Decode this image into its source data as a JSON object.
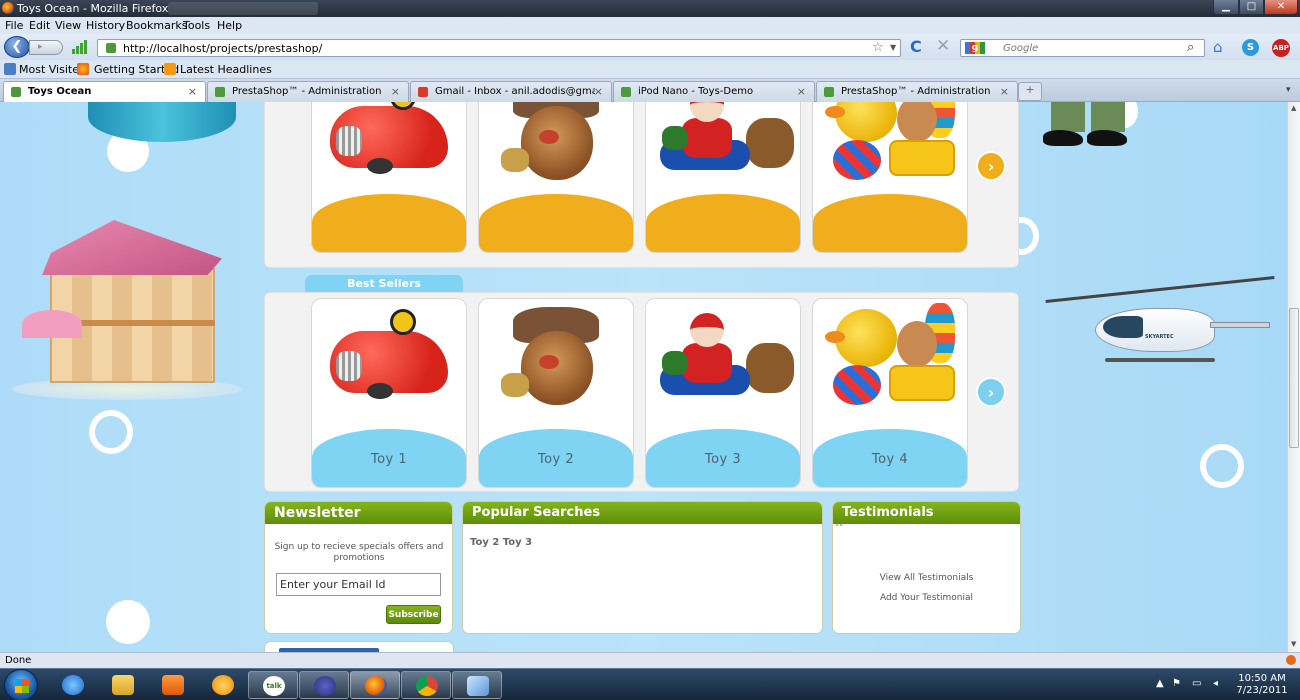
{
  "window": {
    "title": "Toys Ocean - Mozilla Firefox",
    "controls": {
      "minimize": "▁",
      "maximize": "□",
      "close": "✕"
    }
  },
  "menu": [
    "File",
    "Edit",
    "View",
    "History",
    "Bookmarks",
    "Tools",
    "Help"
  ],
  "nav": {
    "url": "http://localhost/projects/prestashop/",
    "search_placeholder": "Google",
    "back": "❮",
    "forward": "▸",
    "bookmark_star": "☆",
    "url_dropdown": "▼",
    "reload": "C",
    "stop": "✕",
    "home": "⌂",
    "search_engine_badge": "g",
    "search_lens": "⌕",
    "skype_badge": "S",
    "adblock_badge": "ABP"
  },
  "bookmarks": [
    "Most Visited",
    "Getting Started",
    "Latest Headlines"
  ],
  "tabs": [
    {
      "label": "Toys Ocean",
      "active": true
    },
    {
      "label": "PrestaShop™ - Administration panel",
      "active": false
    },
    {
      "label": "Gmail - Inbox - anil.adodis@gmail.c...",
      "active": false
    },
    {
      "label": "iPod Nano - Toys-Demo",
      "active": false
    },
    {
      "label": "PrestaShop™ - Administration panel",
      "active": false
    }
  ],
  "tab_close": "×",
  "new_tab": "+",
  "tab_scroll": "▾",
  "shop": {
    "featured": {
      "band_color": "#f0ae1c",
      "arrow": "›"
    },
    "best_sellers": {
      "title": "Best Sellers",
      "band_color": "#7fd3f3",
      "arrow": "›",
      "products": [
        "Toy 1",
        "Toy 2",
        "Toy 3",
        "Toy 4"
      ]
    },
    "newsletter": {
      "title": "Newsletter",
      "text": "Sign up to recieve specials offers and promotions",
      "input_value": "Enter your Email Id",
      "button": "Subscribe"
    },
    "popular": {
      "title": "Popular Searches",
      "tags": "Toy 2 Toy 3"
    },
    "testimonials": {
      "title": "Testimonials",
      "quote": "\"\"",
      "view_all": "View All Testimonials",
      "add": "Add Your Testimonial"
    },
    "heli_brand": "SKYARTEC"
  },
  "status": "Done",
  "scrollbar": {
    "up": "▲",
    "down": "▼"
  },
  "clock": {
    "time": "10:50 AM",
    "date": "7/23/2011"
  },
  "taskbar": {
    "talk_badge": "talk",
    "tray_icons": [
      "▲",
      "⚑",
      "▭",
      "◂"
    ]
  },
  "colors": {
    "accent_green": "#6a9a12",
    "orange": "#f0ae1c",
    "sky": "#7fd3f3"
  }
}
